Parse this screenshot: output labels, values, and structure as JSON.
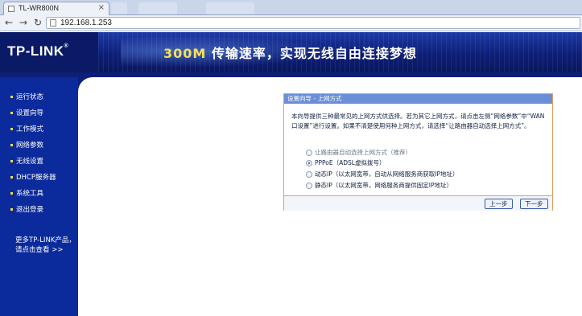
{
  "browser": {
    "tab_title": "TL-WR800N",
    "tab_close": "×",
    "back": "←",
    "forward": "→",
    "reload": "↻",
    "url": "192.168.1.253"
  },
  "banner": {
    "logo": "TP-LINK",
    "logo_mark": "®",
    "slogan_highlight": "300M",
    "slogan_rest": " 传输速率，实现无线自由连接梦想"
  },
  "sidebar": {
    "items": [
      {
        "label": "运行状态"
      },
      {
        "label": "设置向导"
      },
      {
        "label": "工作模式"
      },
      {
        "label": "网络参数"
      },
      {
        "label": "无线设置"
      },
      {
        "label": "DHCP服务器"
      },
      {
        "label": "系统工具"
      },
      {
        "label": "退出登录"
      }
    ],
    "more_line1": "更多TP-LINK产品，",
    "more_line2": "请点击查看 >>"
  },
  "wizard": {
    "header": "设置向导 - 上网方式",
    "description": "本向导提供三种最常见的上网方式供选择。若为其它上网方式，请点击左侧“网络参数”中“WAN口设置”进行设置。如果不清楚使用何种上网方式，请选择“让路由器自动选择上网方式”。",
    "options": [
      {
        "label": "让路由器自动选择上网方式（推荐）",
        "checked": false,
        "disabled": true
      },
      {
        "label": "PPPoE（ADSL虚拟拨号）",
        "checked": true,
        "disabled": false
      },
      {
        "label": "动态IP（以太网宽带，自动从网络服务商获取IP地址）",
        "checked": false,
        "disabled": false
      },
      {
        "label": "静态IP（以太网宽带，网络服务商提供固定IP地址）",
        "checked": false,
        "disabled": false
      }
    ],
    "prev_button": "上一步",
    "next_button": "下一步"
  },
  "colors": {
    "sidebar_bg": "#0b2b9c",
    "banner_bg": "#0e1f78",
    "panel_border": "#e2a05a",
    "panel_header": "#6a8fd6"
  }
}
